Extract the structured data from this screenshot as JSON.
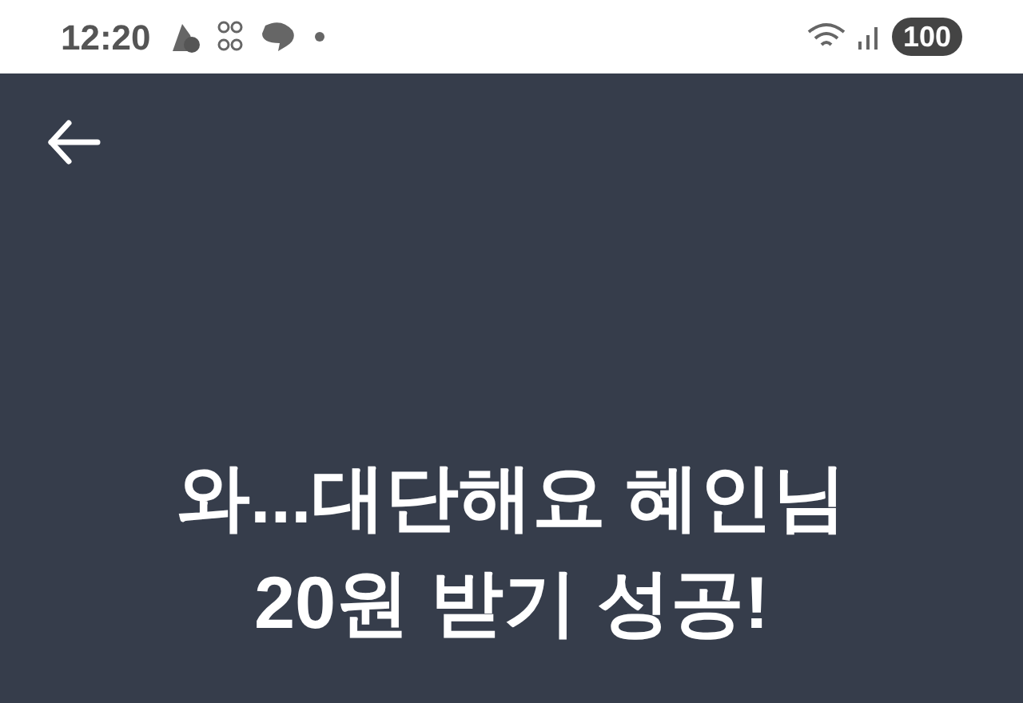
{
  "status_bar": {
    "time": "12:20",
    "battery": "100"
  },
  "headline": [
    "와...대단해요 혜인님",
    "20원 받기 성공!"
  ]
}
